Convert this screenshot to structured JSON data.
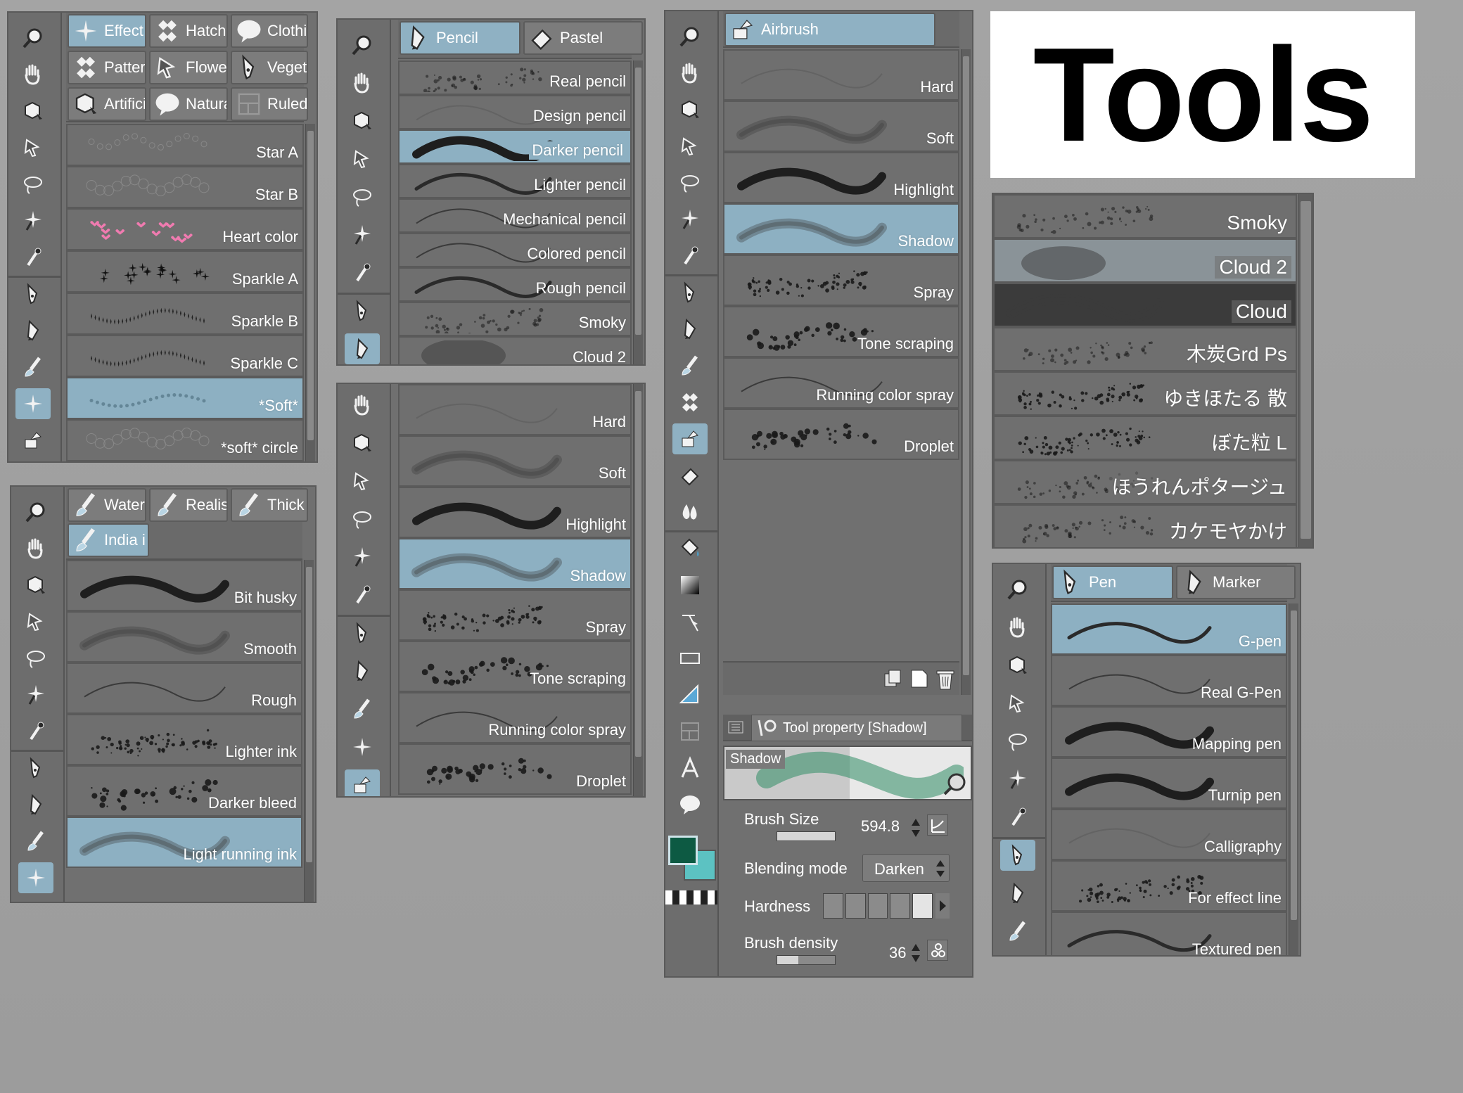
{
  "title": "Tools",
  "icons": {
    "rail_a": [
      "zoom-icon",
      "hand-icon",
      "move-layer-icon",
      "operation-icon",
      "lasso-icon",
      "magic-wand-icon",
      "eyedropper-icon",
      "pen-icon",
      "pencil-icon",
      "brush-icon",
      "decoration-icon",
      "airbrush-icon"
    ],
    "rail_b": [
      "zoom-icon",
      "hand-icon",
      "move-layer-icon",
      "operation-icon",
      "lasso-icon",
      "magic-wand-icon",
      "eyedropper-icon",
      "pen-icon",
      "pencil-icon"
    ],
    "rail_c": [
      "hand-icon",
      "move-layer-icon",
      "operation-icon",
      "lasso-icon",
      "magic-wand-icon",
      "eyedropper-icon",
      "pen-icon",
      "pencil-icon",
      "brush-icon",
      "decoration-icon",
      "airbrush-icon"
    ],
    "rail_d": [
      "zoom-icon",
      "hand-icon",
      "move-layer-icon",
      "operation-icon",
      "lasso-icon",
      "magic-wand-icon",
      "eyedropper-icon",
      "pen-icon",
      "pencil-icon",
      "brush-icon",
      "blend-icon",
      "airbrush-icon",
      "eraser-icon",
      "water-drop-icon",
      "fill-icon",
      "gradient-icon",
      "figure-icon",
      "rectangle-icon",
      "ruler-icon",
      "frame-icon",
      "text-icon",
      "balloon-icon"
    ],
    "rail_e": [
      "zoom-icon",
      "hand-icon",
      "move-layer-icon",
      "operation-icon",
      "lasso-icon",
      "magic-wand-icon",
      "eyedropper-icon",
      "pen-icon",
      "pencil-icon",
      "brush-icon",
      "decoration-icon"
    ]
  },
  "panels": {
    "decoration": {
      "tabs": [
        "Effect",
        "Hatch",
        "Clothi",
        "Pattern",
        "Flowe",
        "Veget",
        "Artifici",
        "Natura",
        "Ruled"
      ],
      "items": [
        "Star A",
        "Star B",
        "Heart color",
        "Sparkle A",
        "Sparkle B",
        "Sparkle C",
        "*Soft*",
        "*soft* circle"
      ],
      "active": "*Soft*"
    },
    "ink": {
      "tabs": [
        "Water",
        "Realis",
        "Thick",
        "India i"
      ],
      "items": [
        "Bit husky",
        "Smooth",
        "Rough",
        "Lighter ink",
        "Darker bleed",
        "Light running ink"
      ],
      "active": "Light running ink"
    },
    "pencil": {
      "tabs": [
        "Pencil",
        "Pastel"
      ],
      "items": [
        "Real pencil",
        "Design pencil",
        "Darker pencil",
        "Lighter pencil",
        "Mechanical pencil",
        "Colored pencil",
        "Rough pencil",
        "Smoky",
        "Cloud 2"
      ],
      "active": "Darker pencil"
    },
    "airbrush_small": {
      "items": [
        "Hard",
        "Soft",
        "Highlight",
        "Shadow",
        "Spray",
        "Tone scraping",
        "Running color spray",
        "Droplet"
      ],
      "active": "Shadow"
    },
    "airbrush": {
      "tabs": [
        "Airbrush"
      ],
      "items": [
        "Hard",
        "Soft",
        "Highlight",
        "Shadow",
        "Spray",
        "Tone scraping",
        "Running color spray",
        "Droplet"
      ],
      "active": "Shadow",
      "property_title": "Tool property [Shadow]",
      "preview_label": "Shadow",
      "brush_size_label": "Brush Size",
      "brush_size": "594.8",
      "blending_label": "Blending mode",
      "blending_value": "Darken",
      "hardness_label": "Hardness",
      "density_label": "Brush density",
      "density": "36",
      "main_color": "#0d5a43",
      "sub_color": "#5cc2c2"
    },
    "custom": {
      "items": [
        "Smoky",
        "Cloud 2",
        "Cloud",
        "木炭Grd Ps",
        "ゆきほたる 散",
        "ぼた粒 L",
        "ほうれんポタージュ",
        "カケモヤかけ"
      ]
    },
    "pen": {
      "tabs": [
        "Pen",
        "Marker"
      ],
      "items": [
        "G-pen",
        "Real G-Pen",
        "Mapping pen",
        "Turnip pen",
        "Calligraphy",
        "For effect line",
        "Textured pen"
      ],
      "active": "G-pen"
    }
  }
}
